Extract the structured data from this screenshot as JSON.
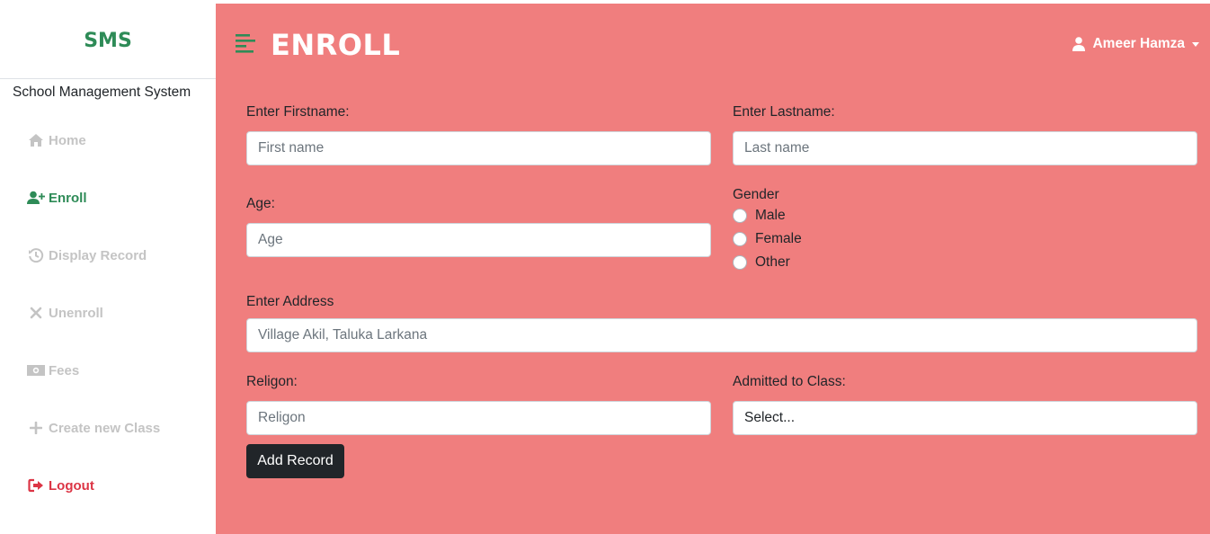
{
  "sidebar": {
    "brand": "SMS",
    "subtitle": "School Management System",
    "items": [
      {
        "label": "Home",
        "icon": "home-icon"
      },
      {
        "label": "Enroll",
        "icon": "user-plus-icon"
      },
      {
        "label": "Display Record",
        "icon": "history-icon"
      },
      {
        "label": "Unenroll",
        "icon": "times-icon"
      },
      {
        "label": "Fees",
        "icon": "money-icon"
      },
      {
        "label": "Create new Class",
        "icon": "plus-icon"
      },
      {
        "label": "Logout",
        "icon": "sign-out-icon"
      }
    ]
  },
  "header": {
    "title": "ENROLL",
    "user": "Ameer Hamza"
  },
  "form": {
    "firstname_label": "Enter Firstname:",
    "firstname_placeholder": "First name",
    "lastname_label": "Enter Lastname:",
    "lastname_placeholder": "Last name",
    "age_label": "Age:",
    "age_placeholder": "Age",
    "gender_label": "Gender",
    "gender_options": [
      "Male",
      "Female",
      "Other"
    ],
    "address_label": "Enter Address",
    "address_placeholder": "Village Akil, Taluka Larkana",
    "religion_label": "Religon:",
    "religion_placeholder": "Religon",
    "class_label": "Admitted to Class:",
    "class_selected": "Select...",
    "submit_label": "Add Record"
  },
  "colors": {
    "main_bg": "#f07e7e",
    "brand": "#2e8b57",
    "logout": "#dc3545",
    "inactive": "#c4c4c4",
    "button": "#212529"
  }
}
